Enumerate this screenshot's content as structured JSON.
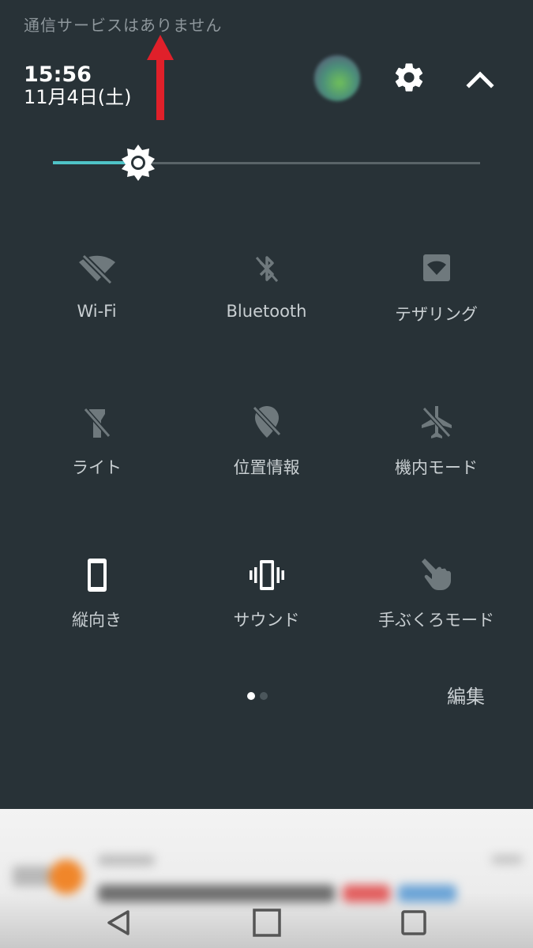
{
  "status_bar": {
    "carrier_text": "通信サービスはありません"
  },
  "header": {
    "time": "15:56",
    "date": "11月4日(土)"
  },
  "brightness": {
    "level_percent": 20
  },
  "quick_settings": {
    "tiles": [
      {
        "label": "Wi-Fi",
        "icon": "wifi-off-icon",
        "active": false
      },
      {
        "label": "Bluetooth",
        "icon": "bluetooth-off-icon",
        "active": false
      },
      {
        "label": "テザリング",
        "icon": "tethering-icon",
        "active": false
      },
      {
        "label": "ライト",
        "icon": "flashlight-off-icon",
        "active": false
      },
      {
        "label": "位置情報",
        "icon": "location-off-icon",
        "active": false
      },
      {
        "label": "機内モード",
        "icon": "airplane-off-icon",
        "active": false
      },
      {
        "label": "縦向き",
        "icon": "portrait-icon",
        "active": true
      },
      {
        "label": "サウンド",
        "icon": "vibrate-icon",
        "active": true
      },
      {
        "label": "手ぶくろモード",
        "icon": "glove-icon",
        "active": false
      }
    ],
    "page_indicator": {
      "pages": 2,
      "current": 1
    },
    "edit_label": "編集"
  },
  "colors": {
    "panel_bg": "#283237",
    "accent": "#4fc3c7",
    "inactive_icon": "#6f797d",
    "annotation_arrow": "#e0202a"
  }
}
